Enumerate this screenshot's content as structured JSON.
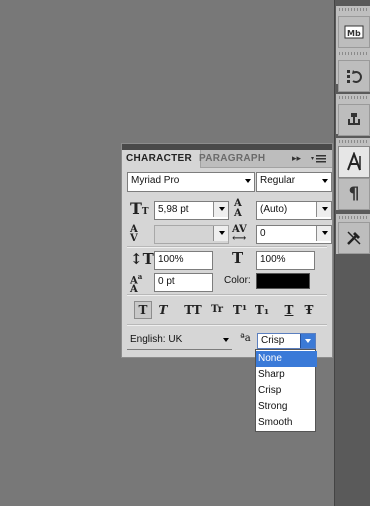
{
  "panel": {
    "tabs": [
      "CHARACTER",
      "PARAGRAPH"
    ],
    "menu_icon": "panel-menu-icon",
    "font_family": "Myriad Pro",
    "font_style": "Regular",
    "font_size": "5,98 pt",
    "leading": "(Auto)",
    "kerning": "",
    "tracking": "0",
    "vertical_scale": "100%",
    "horizontal_scale": "100%",
    "baseline_shift": "0 pt",
    "color_label": "Color:",
    "color_value": "#000000",
    "language": "English: UK",
    "antialias_label": "ªa",
    "antialias": "Crisp",
    "style_buttons": [
      "T",
      "T",
      "TT",
      "Tr",
      "T¹",
      "T₁",
      "T",
      "Ŧ"
    ]
  },
  "dropdown": {
    "options": [
      "None",
      "Sharp",
      "Crisp",
      "Strong",
      "Smooth"
    ],
    "highlighted": "None"
  },
  "dock": {
    "icons": [
      "mini-bridge-icon",
      "history-icon",
      "clone-source-icon",
      "character-icon",
      "paragraph-icon",
      "tool-presets-icon"
    ]
  },
  "colors": {
    "highlight": "#3a7ad8",
    "canvas": "#787878"
  }
}
